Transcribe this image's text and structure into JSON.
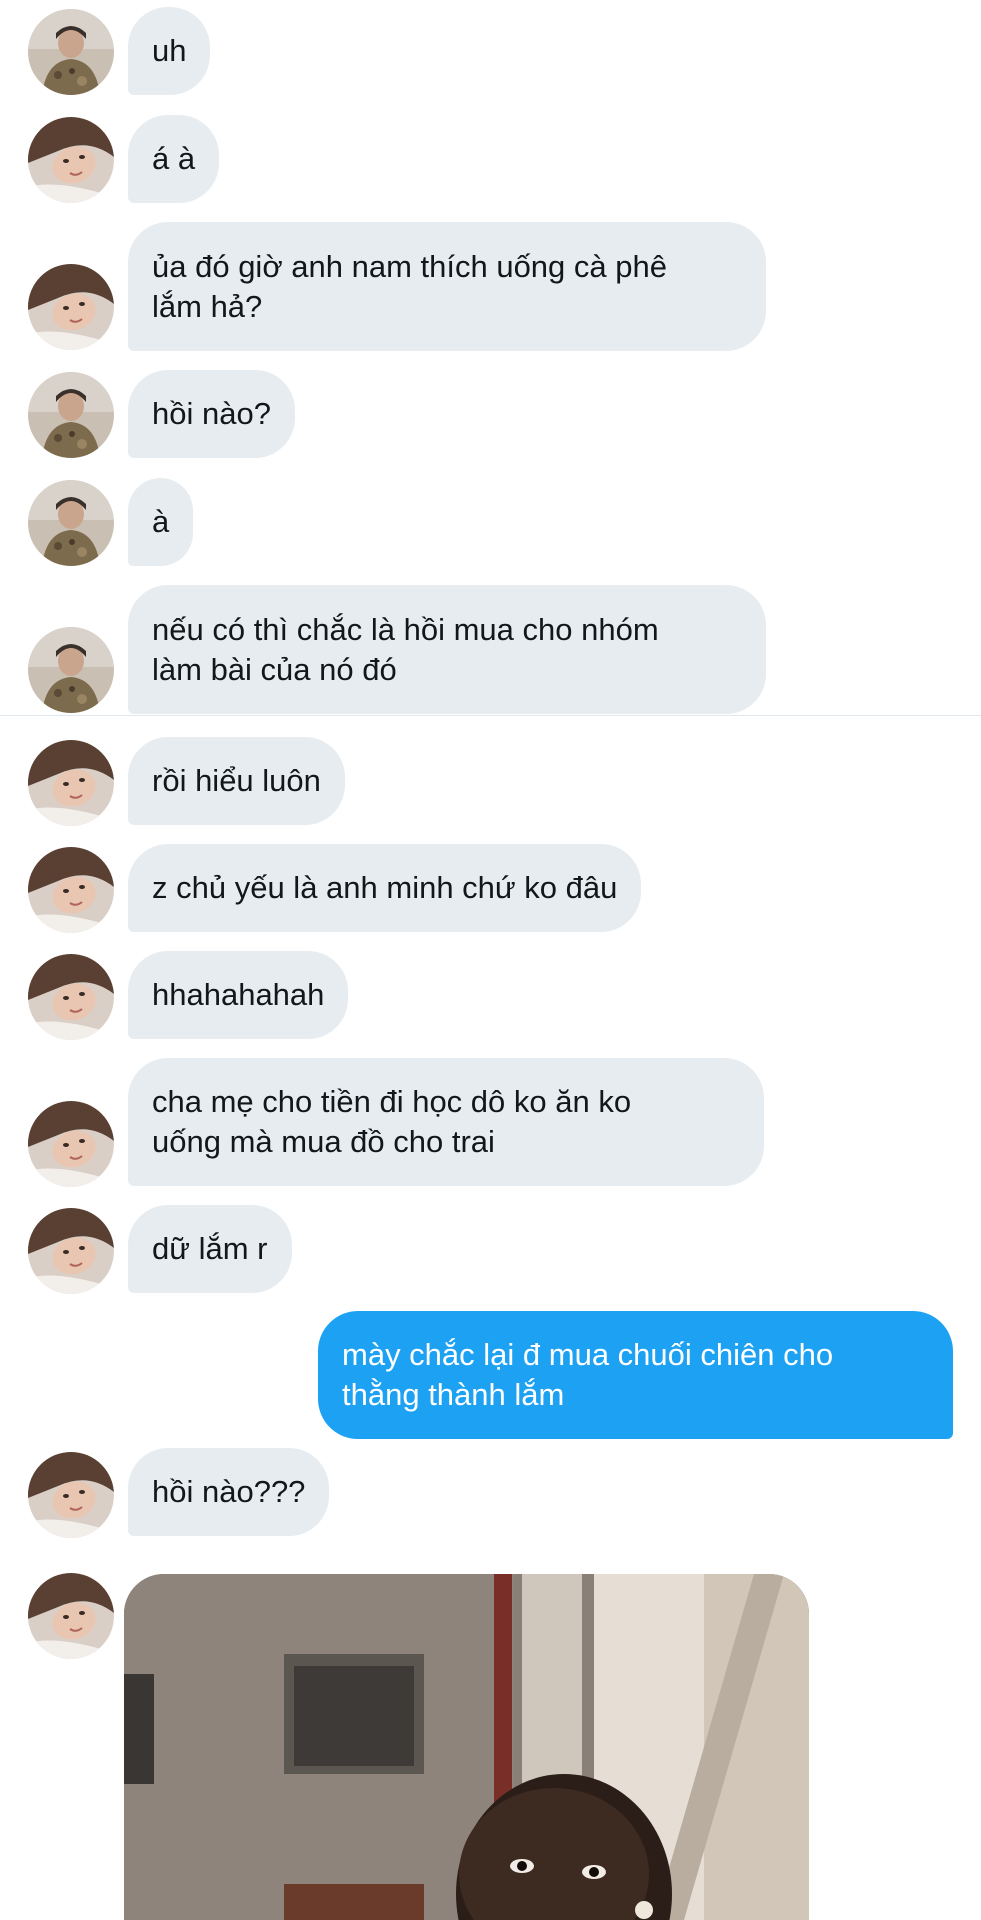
{
  "conversation": {
    "messages": [
      {
        "sender": "friend_a",
        "text": "uh"
      },
      {
        "sender": "friend_b",
        "text": "á à"
      },
      {
        "sender": "friend_b",
        "text": "ủa đó giờ anh nam thích uống cà phê\nlắm hả?"
      },
      {
        "sender": "friend_a",
        "text": "hồi nào?"
      },
      {
        "sender": "friend_a",
        "text": "à"
      },
      {
        "sender": "friend_a",
        "text": "nếu có thì chắc là hồi mua cho nhóm\nlàm bài của nó đó"
      },
      {
        "sender": "friend_b",
        "text": "rồi hiểu luôn"
      },
      {
        "sender": "friend_b",
        "text": "z chủ yếu là anh minh chứ ko đâu"
      },
      {
        "sender": "friend_b",
        "text": "hhahahahah"
      },
      {
        "sender": "friend_b",
        "text": "cha mẹ cho tiền đi học dô ko ăn ko\nuống mà mua đồ cho trai"
      },
      {
        "sender": "friend_b",
        "text": "dữ lắm r"
      },
      {
        "sender": "me",
        "text": "mày chắc lại đ mua chuối chiên cho\nthằng thành lắm"
      },
      {
        "sender": "friend_b",
        "text": "hồi nào???"
      },
      {
        "sender": "friend_b",
        "media": "gif-reaction-image"
      }
    ]
  },
  "icons": {
    "avatar_a": "avatar-photo-person-jacket",
    "avatar_b": "avatar-photo-person-lying"
  },
  "colors": {
    "incoming_bubble": "#e6ecf0",
    "outgoing_bubble": "#1da1f2",
    "text": "#14171a",
    "background": "#ffffff"
  }
}
